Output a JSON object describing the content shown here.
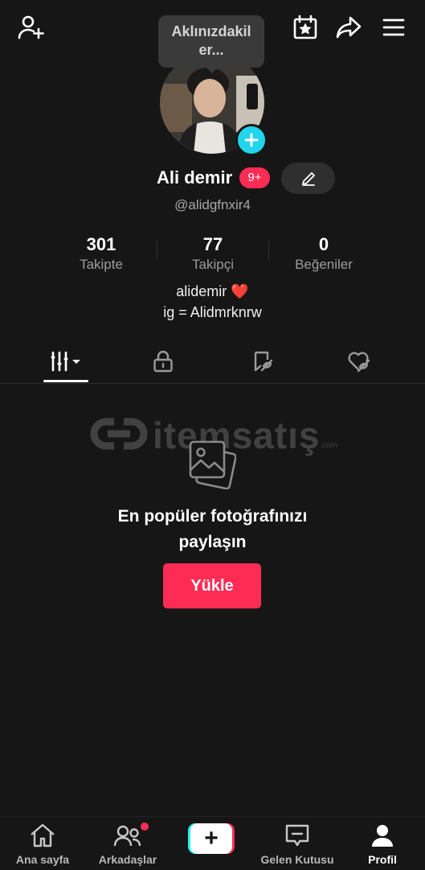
{
  "header": {
    "add_friend_icon": "person-plus-icon",
    "calendar_icon": "calendar-star-icon",
    "share_icon": "share-arrow-icon",
    "menu_icon": "hamburger-menu-icon"
  },
  "profile": {
    "status_bubble": "Aklınızdakil er...",
    "name": "Ali demir",
    "badge": "9+",
    "handle": "@alidgfnxir4",
    "accent_color": "#20d5ec"
  },
  "stats": [
    {
      "value": "301",
      "label": "Takipte"
    },
    {
      "value": "77",
      "label": "Takipçi"
    },
    {
      "value": "0",
      "label": "Beğeniler"
    }
  ],
  "bio": {
    "line1": "alidemir ❤️",
    "line2": "ig = Alidmrknrw"
  },
  "tabs": [
    {
      "icon": "grid-bars-icon",
      "active": true
    },
    {
      "icon": "lock-icon",
      "active": false
    },
    {
      "icon": "bookmark-icon",
      "active": false
    },
    {
      "icon": "heart-hidden-icon",
      "active": false
    }
  ],
  "watermark": {
    "text": "itemsatış",
    "sub": ".com"
  },
  "empty_state": {
    "title_line1": "En popüler fotoğrafınızı",
    "title_line2": "paylaşın",
    "upload_label": "Yükle",
    "button_color": "#fe2c55"
  },
  "bottom_nav": {
    "home": "Ana sayfa",
    "friends": "Arkadaşlar",
    "create": "+",
    "inbox": "Gelen Kutusu",
    "profile": "Profil"
  }
}
